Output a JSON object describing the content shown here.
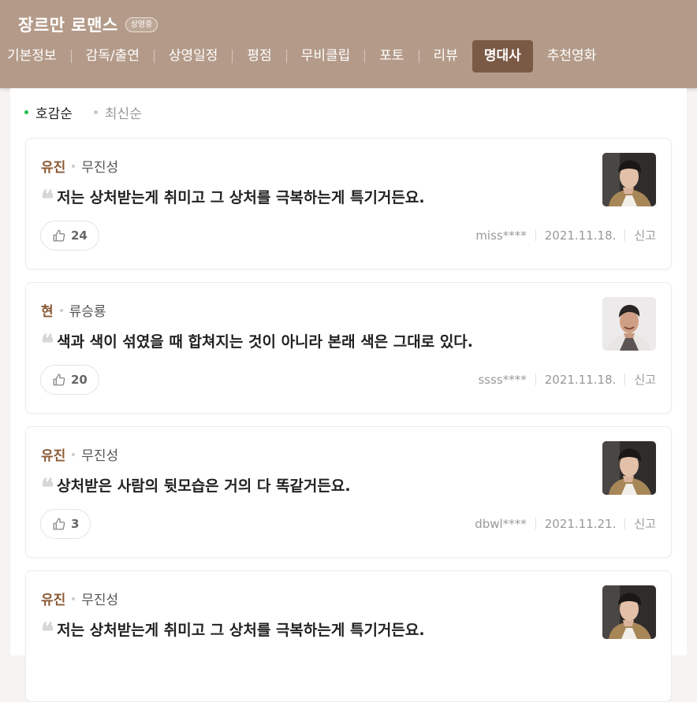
{
  "header": {
    "title": "장르만 로맨스",
    "badge": "상영중",
    "nav": [
      "기본정보",
      "감독/출연",
      "상영일정",
      "평점",
      "무비클립",
      "포토",
      "리뷰",
      "명대사",
      "추천영화"
    ],
    "active_index": 7
  },
  "sort": {
    "options": [
      "호감순",
      "최신순"
    ],
    "active": "호감순"
  },
  "quotes": [
    {
      "role": "유진",
      "actor": "무진성",
      "text": "저는 상처받는게 취미고 그 상처를 극복하는게 특기거든요.",
      "likes": "24",
      "user": "miss****",
      "date": "2021.11.18.",
      "report": "신고",
      "photo_icon": "actor-photo-young-man"
    },
    {
      "role": "현",
      "actor": "류승룡",
      "text": "색과 색이 섞였을 때 합쳐지는 것이 아니라 본래 색은 그대로 있다.",
      "likes": "20",
      "user": "ssss****",
      "date": "2021.11.18.",
      "report": "신고",
      "photo_icon": "actor-photo-middle-aged-man"
    },
    {
      "role": "유진",
      "actor": "무진성",
      "text": "상처받은 사람의 뒷모습은 거의 다 똑같거든요.",
      "likes": "3",
      "user": "dbwl****",
      "date": "2021.11.21.",
      "report": "신고",
      "photo_icon": "actor-photo-young-man"
    },
    {
      "role": "유진",
      "actor": "무진성",
      "text": "저는 상처받는게 취미고 그 상처를 극복하는게 특기거든요.",
      "likes": "",
      "user": "",
      "date": "",
      "report": "",
      "photo_icon": "actor-photo-young-man"
    }
  ],
  "colors": {
    "header": "#b49b89",
    "active_tab": "#7b5a45",
    "role": "#8a5a35",
    "sort_dot_active": "#20c04a"
  }
}
